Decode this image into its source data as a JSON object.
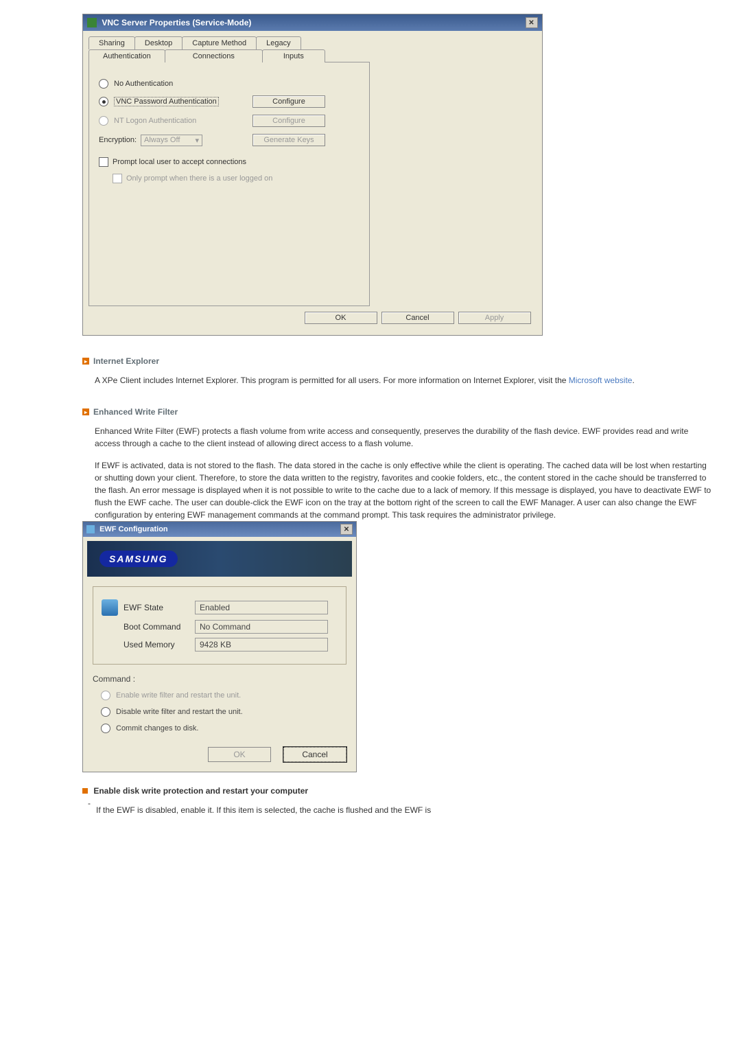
{
  "vnc_dialog": {
    "title": "VNC Server Properties (Service-Mode)",
    "tabs_row1": [
      "Sharing",
      "Desktop",
      "Capture Method",
      "Legacy"
    ],
    "tabs_row2": [
      "Authentication",
      "Connections",
      "Inputs"
    ],
    "radio_no_auth": "No Authentication",
    "radio_vnc_pass": "VNC Password Authentication",
    "btn_configure": "Configure",
    "radio_nt_logon": "NT Logon Authentication",
    "btn_configure2": "Configure",
    "encryption_label": "Encryption:",
    "encryption_value": "Always Off",
    "btn_gen_keys": "Generate Keys",
    "chk_prompt": "Prompt local user to accept connections",
    "chk_only_prompt": "Only prompt when there is a user logged on",
    "btn_ok": "OK",
    "btn_cancel": "Cancel",
    "btn_apply": "Apply"
  },
  "ie_section": {
    "heading": "Internet Explorer",
    "text": "A XPe Client includes Internet Explorer. This program is permitted for all users. For more information on Internet Explorer, visit the ",
    "link": "Microsoft website",
    "suffix": "."
  },
  "ewf_section": {
    "heading": "Enhanced Write Filter",
    "para1": "Enhanced Write Filter (EWF) protects a flash volume from write access and consequently, preserves the durability of the flash device. EWF provides read and write access through a cache to the client instead of allowing direct access to a flash volume.",
    "para2": "If EWF is activated, data is not stored to the flash. The data stored in the cache is only effective while the client is operating. The cached data will be lost when restarting or shutting down your client. Therefore, to store the data written to the registry, favorites and cookie folders, etc., the content stored in the cache should be transferred to the flash.  An error message is displayed when it is not possible to write to the cache due to a lack of memory. If this message is displayed, you have to deactivate EWF to flush the EWF cache. The user can double-click the EWF icon on the tray at the bottom right of the screen to call the EWF Manager. A user can also change the EWF configuration by entering EWF management commands at the command prompt. This task requires the administrator privilege."
  },
  "ewf_dialog": {
    "title": "EWF Configuration",
    "logo": "SAMSUNG",
    "state_label": "EWF State",
    "state_value": "Enabled",
    "boot_label": "Boot Command",
    "boot_value": "No Command",
    "mem_label": "Used Memory",
    "mem_value": "9428 KB",
    "cmd_heading": "Command :",
    "radio_enable": "Enable write filter and restart the unit.",
    "radio_disable": "Disable write filter and restart the unit.",
    "radio_commit": "Commit changes to disk.",
    "btn_ok": "OK",
    "btn_cancel": "Cancel"
  },
  "enable_section": {
    "heading": "Enable disk write protection and restart your computer",
    "dash": "-",
    "text": "If the EWF is disabled, enable it. If this item is selected, the cache is flushed and the EWF is"
  }
}
